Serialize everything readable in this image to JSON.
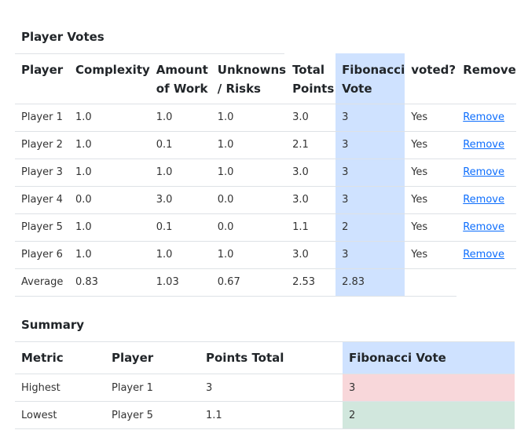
{
  "votes": {
    "title": "Player Votes",
    "headers": {
      "player": "Player",
      "complexity": "Complexity",
      "amount": "Amount of Work",
      "unknowns": "Unknowns / Risks",
      "total": "Total Points",
      "fib": "Fibonacci Vote",
      "voted": "voted?",
      "remove": "Remove"
    },
    "rows": [
      {
        "player": "Player 1",
        "complexity": "1.0",
        "amount": "1.0",
        "unknowns": "1.0",
        "total": "3.0",
        "fib": "3",
        "voted": "Yes",
        "remove": "Remove"
      },
      {
        "player": "Player 2",
        "complexity": "1.0",
        "amount": "0.1",
        "unknowns": "1.0",
        "total": "2.1",
        "fib": "3",
        "voted": "Yes",
        "remove": "Remove"
      },
      {
        "player": "Player 3",
        "complexity": "1.0",
        "amount": "1.0",
        "unknowns": "1.0",
        "total": "3.0",
        "fib": "3",
        "voted": "Yes",
        "remove": "Remove"
      },
      {
        "player": "Player 4",
        "complexity": "0.0",
        "amount": "3.0",
        "unknowns": "0.0",
        "total": "3.0",
        "fib": "3",
        "voted": "Yes",
        "remove": "Remove"
      },
      {
        "player": "Player 5",
        "complexity": "1.0",
        "amount": "0.1",
        "unknowns": "0.0",
        "total": "1.1",
        "fib": "2",
        "voted": "Yes",
        "remove": "Remove"
      },
      {
        "player": "Player 6",
        "complexity": "1.0",
        "amount": "1.0",
        "unknowns": "1.0",
        "total": "3.0",
        "fib": "3",
        "voted": "Yes",
        "remove": "Remove"
      }
    ],
    "average": {
      "player": "Average",
      "complexity": "0.83",
      "amount": "1.03",
      "unknowns": "0.67",
      "total": "2.53",
      "fib": "2.83"
    }
  },
  "summary": {
    "title": "Summary",
    "headers": {
      "metric": "Metric",
      "player": "Player",
      "points": "Points Total",
      "fib": "Fibonacci Vote"
    },
    "rows": [
      {
        "metric": "Highest",
        "player": "Player 1",
        "points": "3",
        "fib": "3"
      },
      {
        "metric": "Lowest",
        "player": "Player 5",
        "points": "1.1",
        "fib": "2"
      }
    ]
  },
  "colors": {
    "fib_highlight": "#cfe2ff",
    "highest": "#f8d7da",
    "lowest": "#d1e7dd",
    "link": "#0d6efd"
  }
}
